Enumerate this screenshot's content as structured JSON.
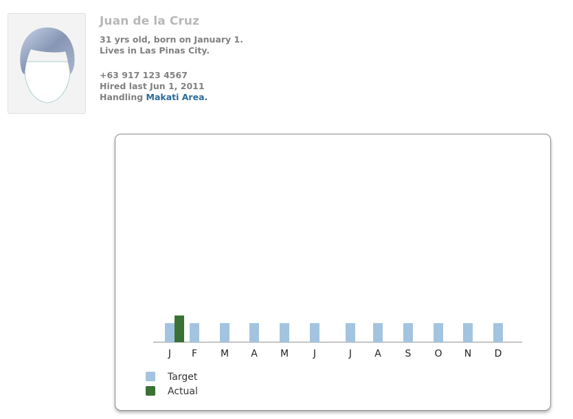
{
  "profile": {
    "name": "Juan de la Cruz",
    "age_birth": "31 yrs old, born on January 1.",
    "residence": "Lives in Las Pinas City.",
    "phone": "+63 917 123 4567",
    "hired": "Hired last Jun 1, 2011",
    "handling_prefix": "Handling ",
    "handling_area": "Makati Area."
  },
  "colors": {
    "target": "#a3c4e0",
    "actual": "#3a7134",
    "link": "#2a6a98"
  },
  "chart_data": {
    "type": "bar",
    "categories": [
      "J",
      "F",
      "M",
      "A",
      "M",
      "J",
      "J",
      "A",
      "S",
      "O",
      "N",
      "D"
    ],
    "series": [
      {
        "name": "Target",
        "values": [
          1,
          1,
          1,
          1,
          1,
          1,
          1,
          1,
          1,
          1,
          1,
          1
        ]
      },
      {
        "name": "Actual",
        "values": [
          1.4,
          0,
          0,
          0,
          0,
          0,
          0,
          0,
          0,
          0,
          0,
          0
        ]
      }
    ],
    "ylim": [
      0,
      10
    ],
    "grid": false,
    "legend": "bottom-left"
  }
}
